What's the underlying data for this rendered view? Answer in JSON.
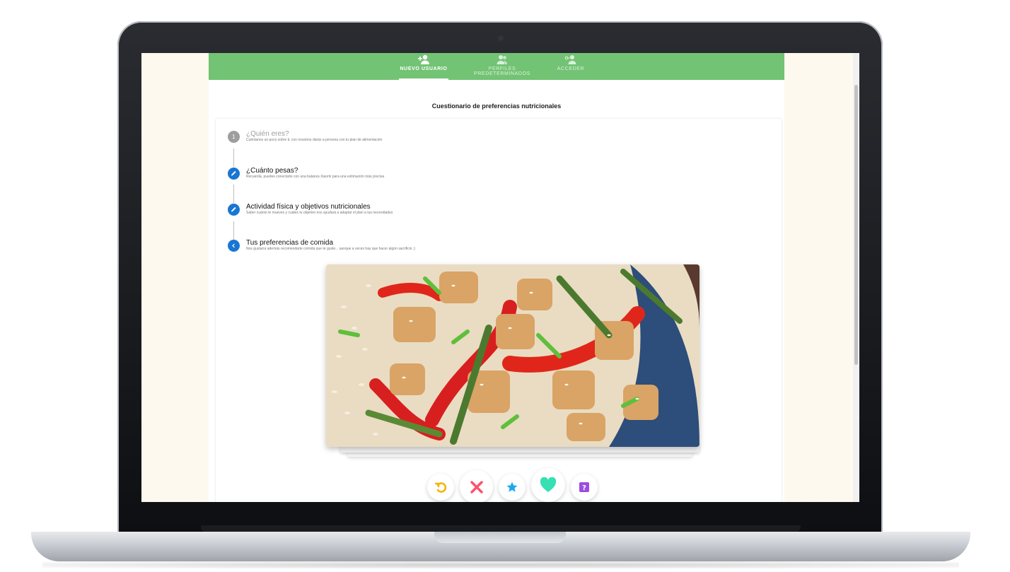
{
  "nav": {
    "tabs": [
      {
        "label": "NUEVO USUARIO",
        "icon": "add-user-icon",
        "active": true
      },
      {
        "label": "PERFILES PREDETERMINADOS",
        "icon": "users-icon",
        "active": false
      },
      {
        "label": "ACCEDER",
        "icon": "key-user-icon",
        "active": false
      }
    ]
  },
  "questionnaire": {
    "title": "Cuestionario de preferencias nutricionales",
    "steps": [
      {
        "number": "1",
        "title": "¿Quién eres?",
        "subtitle": "Cuéntanos un poco sobre ti, con nosotros darás a persona con tu plan de alimentación",
        "state": "pending"
      },
      {
        "number": "",
        "title": "¿Cuánto pesas?",
        "subtitle": "Recuerda, puedes conectarte con una balanza Xiaomi para una estimación más precisa",
        "state": "edit"
      },
      {
        "number": "",
        "title": "Actividad física y objetivos nutricionales",
        "subtitle": "Saber cuánto te mueves y cuáles tu objetivo nos ayudará a adaptar el plan a tus necesidades",
        "state": "edit"
      },
      {
        "number": "",
        "title": "Tus preferencias de comida",
        "subtitle": "Nos gustaría además recomendarte comida que te guste... aunque a veces hay que hacer algún sacrificio ;)",
        "state": "current"
      }
    ]
  },
  "actions": [
    {
      "name": "undo",
      "icon": "undo-icon",
      "color": "#f5b400"
    },
    {
      "name": "dislike",
      "icon": "close-icon",
      "color": "#ff4f6b"
    },
    {
      "name": "superlike",
      "icon": "star-icon",
      "color": "#1fa8ec"
    },
    {
      "name": "like",
      "icon": "heart-icon",
      "color": "#36e0b2"
    },
    {
      "name": "unknown",
      "icon": "question-icon",
      "color": "#9b4de0"
    }
  ],
  "colors": {
    "topbar": "#72c374",
    "step_active": "#1976d2",
    "step_pending": "#9e9e9e"
  }
}
